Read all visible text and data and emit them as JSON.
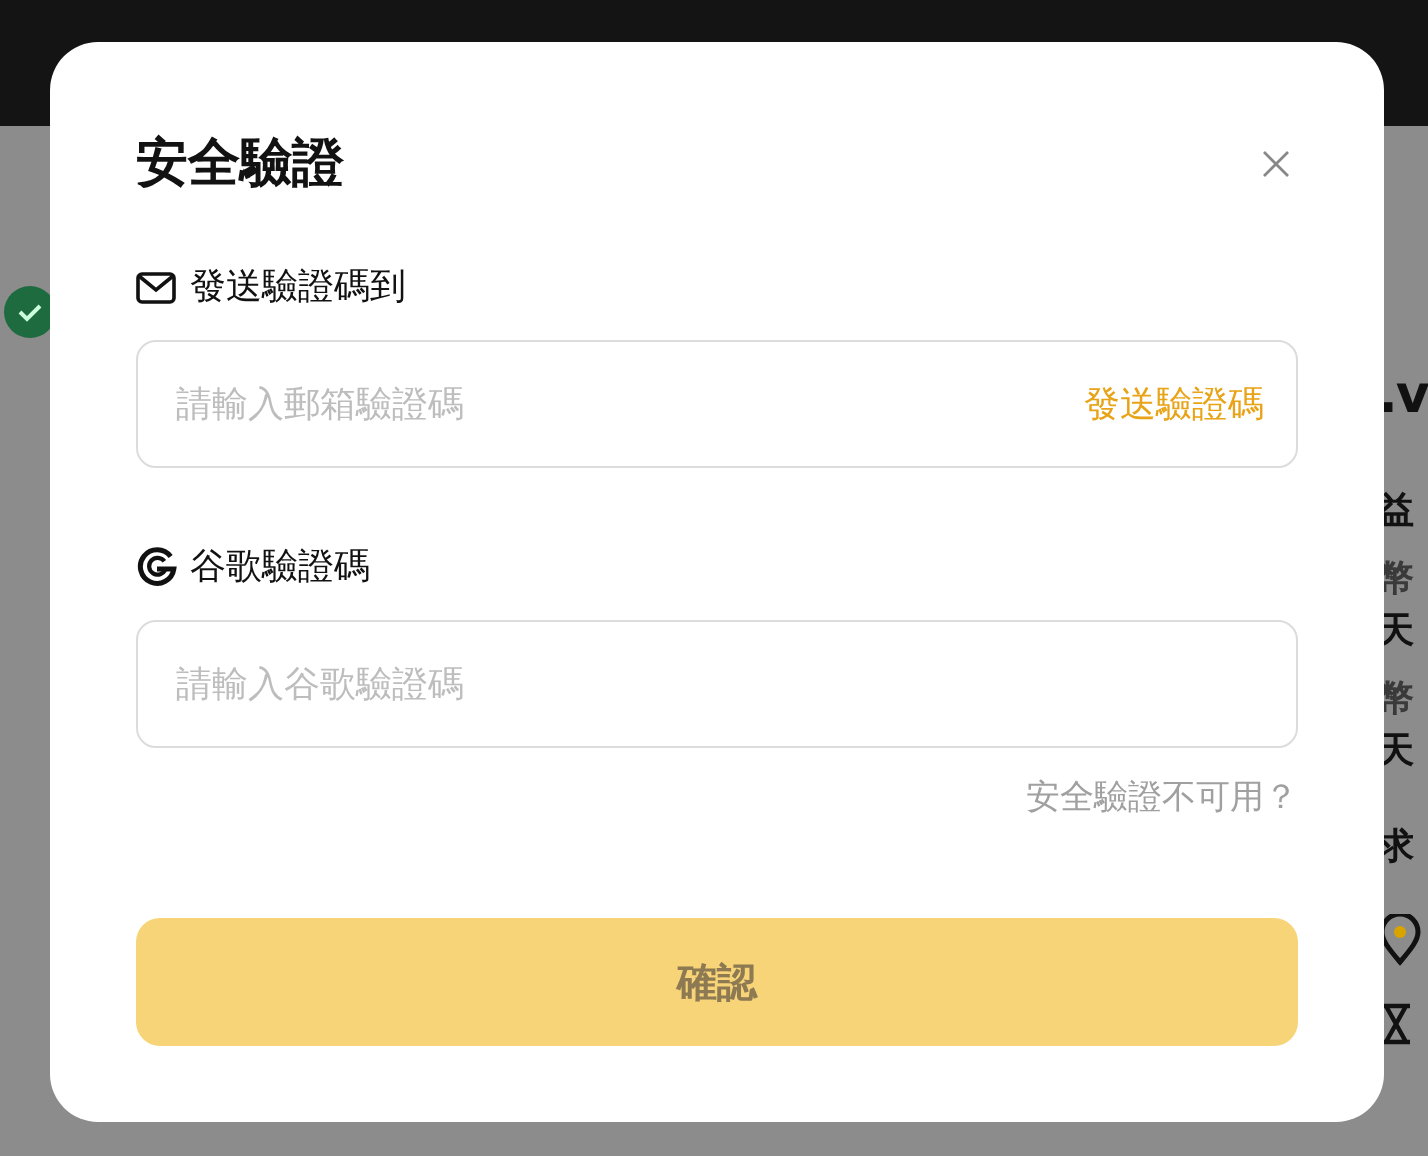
{
  "background": {
    "texts": [
      ".v",
      "益",
      "幣",
      "天",
      "幣",
      "天",
      "求"
    ]
  },
  "dialog": {
    "title": "安全驗證",
    "email": {
      "label": "發送驗證碼到",
      "placeholder": "請輸入郵箱驗證碼",
      "send_button": "發送驗證碼"
    },
    "google": {
      "label": "谷歌驗證碼",
      "placeholder": "請輸入谷歌驗證碼"
    },
    "unavailable_link": "安全驗證不可用？",
    "confirm_button": {
      "label": "確認",
      "disabled": true
    }
  }
}
